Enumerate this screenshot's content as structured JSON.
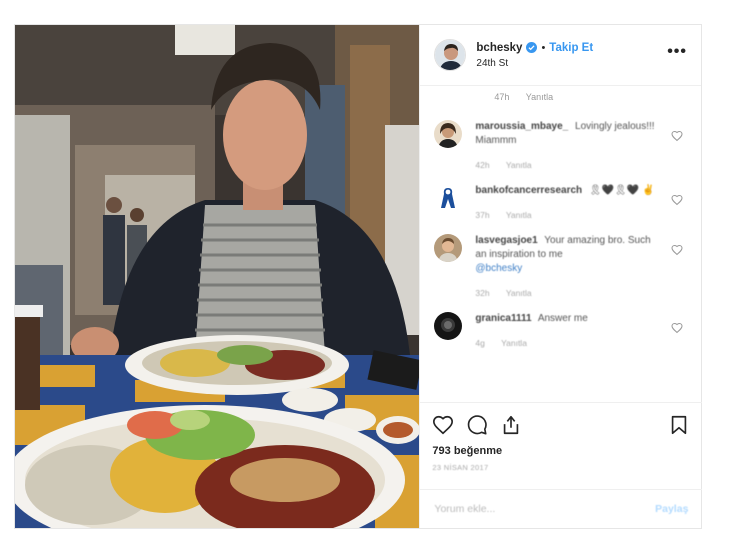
{
  "header": {
    "username": "bchesky",
    "dot": "•",
    "follow_label": "Takip Et",
    "location": "24th St",
    "more": "•••"
  },
  "top_meta": {
    "time": "47h",
    "reply": "Yanıtla"
  },
  "comments": [
    {
      "user": "maroussia_mbaye_",
      "text": "Lovingly jealous!!! Miammm",
      "mention": "",
      "time": "42h",
      "reply": "Yanıtla"
    },
    {
      "user": "bankofcancerresearch",
      "text": "🎗🖤🎗🖤 ✌",
      "mention": "",
      "time": "37h",
      "reply": "Yanıtla"
    },
    {
      "user": "lasvegasjoe1",
      "text": "Your amazing bro. Such an inspiration to me",
      "mention": "@bchesky",
      "time": "32h",
      "reply": "Yanıtla"
    },
    {
      "user": "granica1111",
      "text": "Answer me",
      "mention": "",
      "time": "4g",
      "reply": "Yanıtla"
    }
  ],
  "likes": "793 beğenme",
  "date": "23 NİSAN 2017",
  "add_comment": {
    "placeholder": "Yorum ekle...",
    "post_label": "Paylaş"
  },
  "icons": [
    "heart-icon",
    "comment-icon",
    "share-icon",
    "bookmark-icon",
    "verified-badge-icon",
    "more-options-icon"
  ],
  "colors": {
    "accent": "#3897f0",
    "border": "#efefef",
    "muted": "#999999"
  }
}
